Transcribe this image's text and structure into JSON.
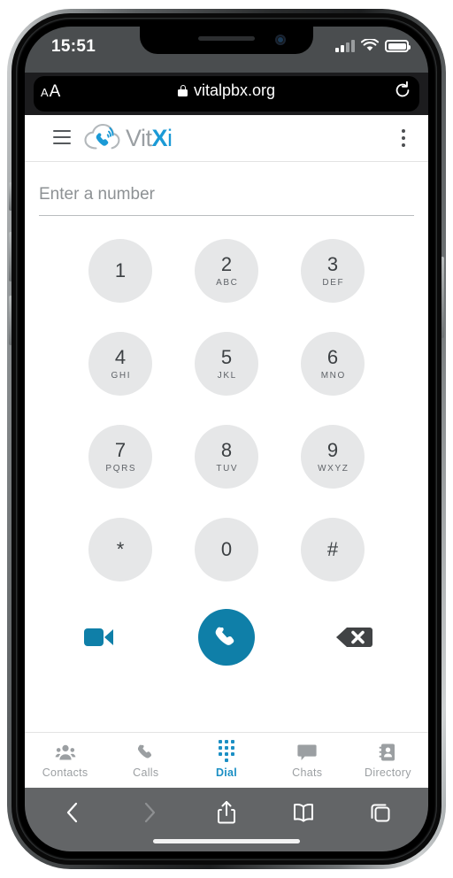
{
  "device": {
    "status_bar": {
      "time": "15:51",
      "signal_icon": "cellular-signal-icon",
      "wifi_icon": "wifi-icon",
      "battery_icon": "battery-full-icon"
    },
    "browser": {
      "text_size_button": {
        "small": "A",
        "large": "A"
      },
      "lock_icon": "lock-icon",
      "url": "vitalpbx.org",
      "reload_icon": "reload-icon",
      "toolbar": {
        "back": "back-chevron-icon",
        "forward": "forward-chevron-icon",
        "share": "share-icon",
        "bookmarks": "book-icon",
        "tabs": "tabs-icon"
      }
    }
  },
  "app": {
    "header": {
      "menu_icon": "hamburger-menu-icon",
      "logo": {
        "mark": "vitxi-cloud-phone-logo",
        "part1": "Vit",
        "part2": "X",
        "part3": "i"
      },
      "overflow_icon": "kebab-menu-icon"
    },
    "dialer": {
      "input": {
        "value": "",
        "placeholder": "Enter a number"
      },
      "keys": [
        {
          "digit": "1",
          "letters": ""
        },
        {
          "digit": "2",
          "letters": "ABC"
        },
        {
          "digit": "3",
          "letters": "DEF"
        },
        {
          "digit": "4",
          "letters": "GHI"
        },
        {
          "digit": "5",
          "letters": "JKL"
        },
        {
          "digit": "6",
          "letters": "MNO"
        },
        {
          "digit": "7",
          "letters": "PQRS"
        },
        {
          "digit": "8",
          "letters": "TUV"
        },
        {
          "digit": "9",
          "letters": "WXYZ"
        },
        {
          "digit": "*",
          "letters": ""
        },
        {
          "digit": "0",
          "letters": ""
        },
        {
          "digit": "#",
          "letters": ""
        }
      ],
      "actions": {
        "video_call_icon": "video-camera-icon",
        "call_icon": "phone-handset-icon",
        "backspace_icon": "backspace-delete-icon"
      }
    },
    "nav": [
      {
        "label": "Contacts",
        "icon": "contacts-group-icon",
        "active": false
      },
      {
        "label": "Calls",
        "icon": "phone-handset-icon",
        "active": false
      },
      {
        "label": "Dial",
        "icon": "dialpad-grid-icon",
        "active": true
      },
      {
        "label": "Chats",
        "icon": "chat-bubble-icon",
        "active": false
      },
      {
        "label": "Directory",
        "icon": "address-book-icon",
        "active": false
      }
    ]
  },
  "colors": {
    "brand_blue": "#0f7fa8",
    "accent_blue": "#1b8fc4",
    "key_gray": "#e6e7e8",
    "nav_gray": "#9b9fa2",
    "backspace_dark": "#414345"
  }
}
